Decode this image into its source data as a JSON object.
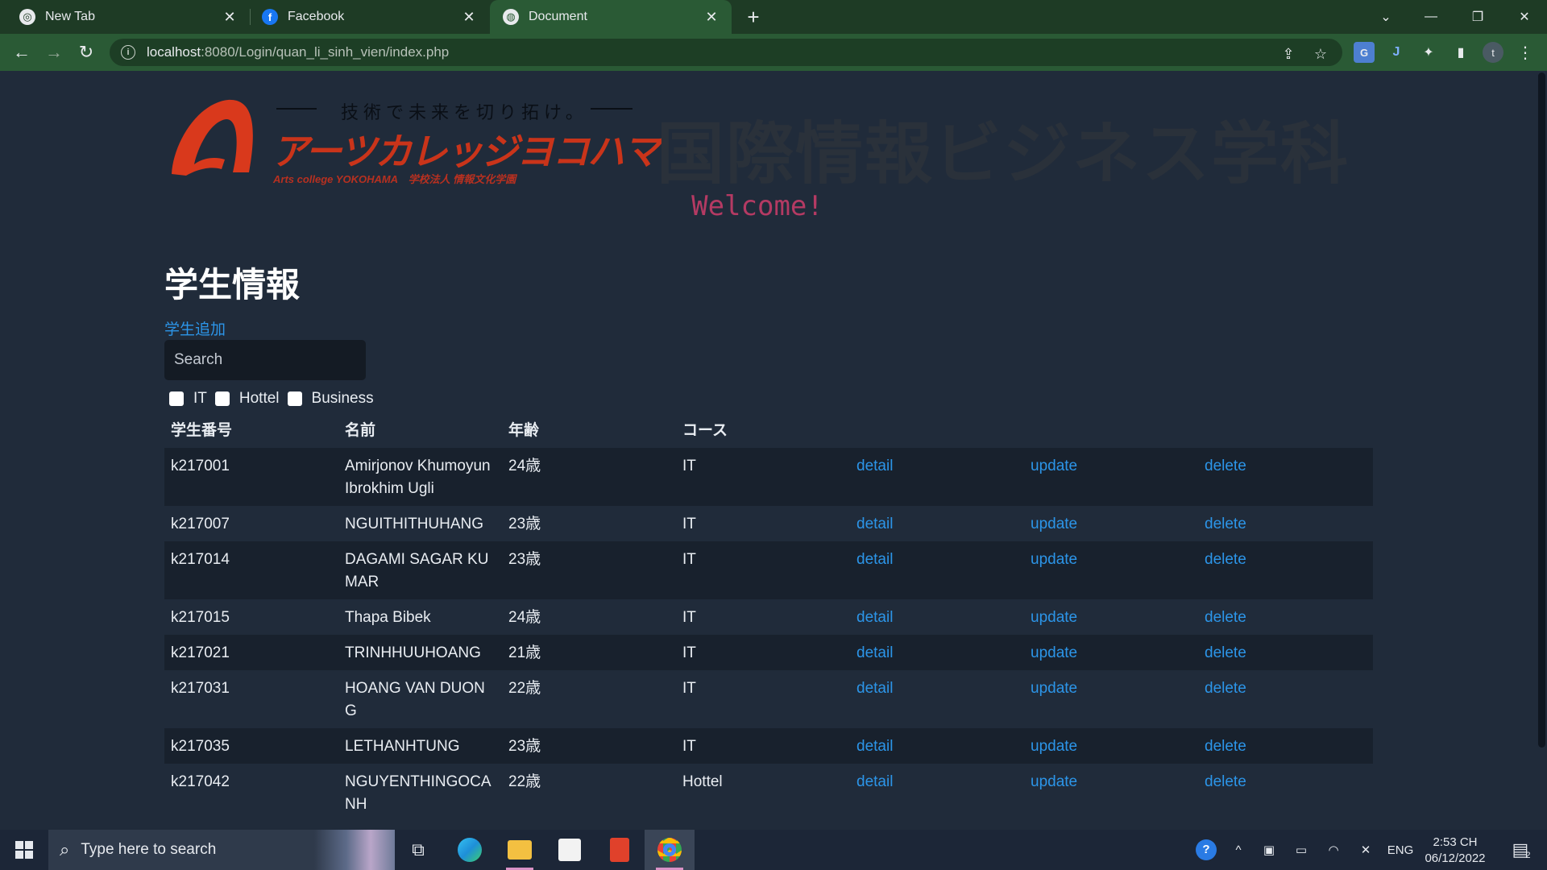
{
  "browser": {
    "tabs": [
      {
        "title": "New Tab",
        "favicon": "chrome-icon"
      },
      {
        "title": "Facebook",
        "favicon": "facebook-icon"
      },
      {
        "title": "Document",
        "favicon": "globe-icon",
        "active": true
      }
    ],
    "url_host": "localhost",
    "url_rest": ":8080/Login/quan_li_sinh_vien/index.php",
    "profile_initial": "t"
  },
  "banner": {
    "slogan": "技術で未来を切り拓け。",
    "logo_text": "アーツカレッジヨコハマ",
    "logo_sub": "Arts college YOKOHAMA　学校法人 情報文化学園",
    "department": "国際情報ビジネス学科",
    "welcome": "Welcome!"
  },
  "page": {
    "title": "学生情報",
    "add_link": "学生追加",
    "search_placeholder": "Search",
    "filters": [
      "IT",
      "Hottel",
      "Business"
    ],
    "columns": [
      "学生番号",
      "名前",
      "年齢",
      "コース",
      "",
      "",
      ""
    ],
    "rows": [
      {
        "id": "k217001",
        "name": "Amirjonov Khumoyun Ibrokhim Ugli",
        "age": "24歳",
        "course": "IT",
        "detail": "detail",
        "update": "update",
        "delete": "delete"
      },
      {
        "id": "k217007",
        "name": "NGUITHITHUHANG",
        "age": "23歳",
        "course": "IT",
        "detail": "detail",
        "update": "update",
        "delete": "delete"
      },
      {
        "id": "k217014",
        "name": "DAGAMI SAGAR KUMAR",
        "age": "23歳",
        "course": "IT",
        "detail": "detail",
        "update": "update",
        "delete": "delete"
      },
      {
        "id": "k217015",
        "name": "Thapa Bibek",
        "age": "24歳",
        "course": "IT",
        "detail": "detail",
        "update": "update",
        "delete": "delete"
      },
      {
        "id": "k217021",
        "name": "TRINHHUUHOANG",
        "age": "21歳",
        "course": "IT",
        "detail": "detail",
        "update": "update",
        "delete": "delete"
      },
      {
        "id": "k217031",
        "name": "HOANG VAN DUONG",
        "age": "22歳",
        "course": "IT",
        "detail": "detail",
        "update": "update",
        "delete": "delete"
      },
      {
        "id": "k217035",
        "name": "LETHANHTUNG",
        "age": "23歳",
        "course": "IT",
        "detail": "detail",
        "update": "update",
        "delete": "delete"
      },
      {
        "id": "k217042",
        "name": "NGUYENTHINGOCANH",
        "age": "22歳",
        "course": "Hottel",
        "detail": "detail",
        "update": "update",
        "delete": "delete"
      }
    ]
  },
  "taskbar": {
    "search_placeholder": "Type here to search",
    "language": "ENG",
    "time": "2:53 CH",
    "date": "06/12/2022",
    "notification_count": "2"
  },
  "colors": {
    "page_bg": "#202b3a",
    "link": "#2c95e8",
    "row_dark": "#18212d",
    "browser_frame": "#2a5a35",
    "welcome": "#b43a63",
    "logo_red": "#c9341a"
  }
}
